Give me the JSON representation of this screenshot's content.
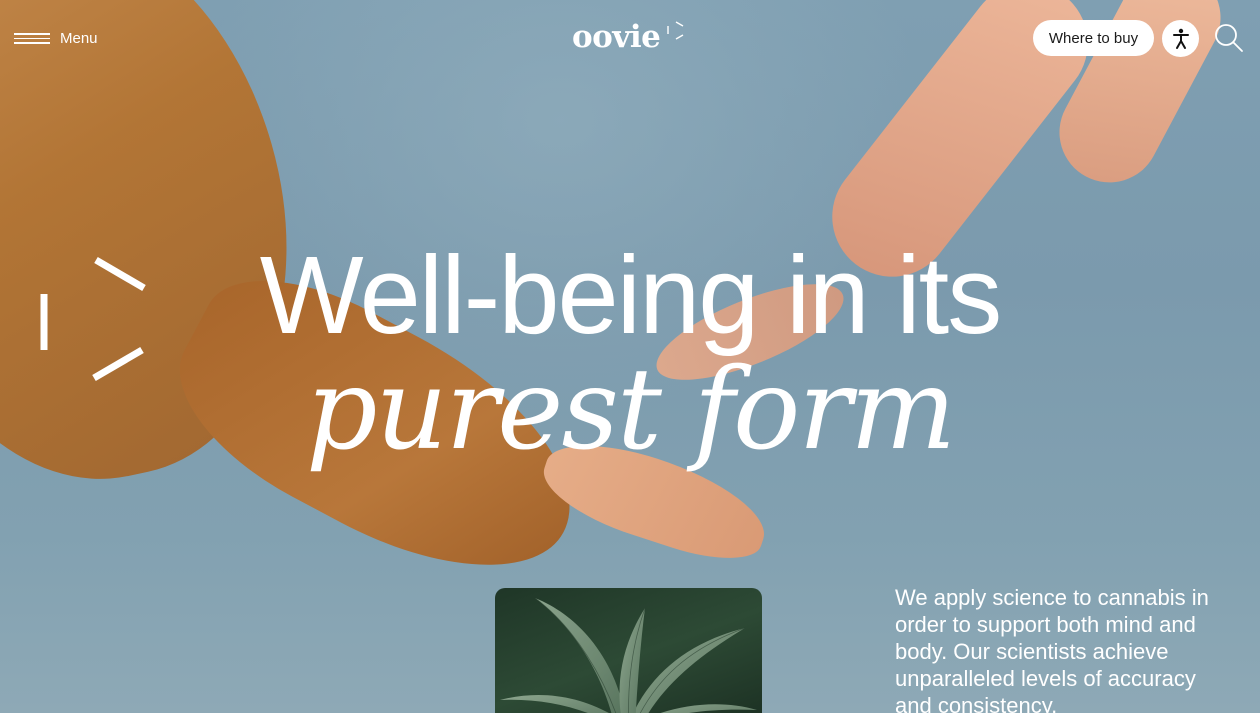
{
  "nav": {
    "menu_label": "Menu",
    "logo_text": "oovie",
    "where_to_buy_label": "Where to buy",
    "accessibility_icon": "accessibility-person-icon",
    "search_icon": "search-icon",
    "menu_icon": "hamburger-menu-icon"
  },
  "hero": {
    "headline_line1": "Well-being in its",
    "headline_line2": "purest form",
    "intro": "We apply science to cannabis in order to support both mind and body. Our scientists achieve unparalleled levels of accuracy and consistency."
  },
  "colors": {
    "sky": "#7f9fb2",
    "sleeve": "#b5732f",
    "text": "#ffffff",
    "button_bg": "#ffffff",
    "button_text": "#1b1b1b",
    "leaf_card": "#2d4a35"
  }
}
